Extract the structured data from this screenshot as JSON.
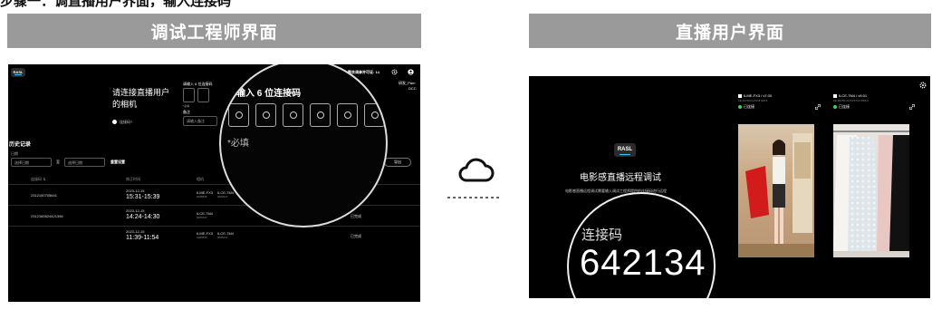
{
  "top_caption": "步骤一：调直播用户界面，输入连接码",
  "left_banner": "调试工程师界面",
  "right_banner": "直播用户界面",
  "engineer": {
    "logo": "RASL",
    "license": "剩余调参许可证: 14",
    "user_name": "研发_Pam",
    "user_sub": "DCC",
    "prompt_title": "请连接直播用户的相机",
    "link_hint": "连接码?",
    "code_label_small": "请输入 6 位连接码",
    "required_small": "*必填",
    "required_small2": "备注",
    "remark_placeholder": "请输入备注",
    "history_title": "历史记录",
    "filter_label": "日期",
    "filter_start": "选择日期",
    "filter_sep": "至",
    "filter_end": "选择日期",
    "reset_label": "重置设置",
    "export_label": "导出",
    "columns": [
      "连接码 ⇅",
      "修正时间",
      "相机",
      "状态"
    ],
    "rows": [
      {
        "code": "2312150705641",
        "date": "2023-12-15",
        "time": "15:31-15:39",
        "cam1": "ILME-FX3",
        "cam1_sn": "0005845",
        "cam2": "ILCE-7M4",
        "cam2_sn": "0005447",
        "status": "已完成"
      },
      {
        "code": "2312160524421396",
        "date": "2023-12-15",
        "time": "14:24-14:30",
        "cam1": "ILCE-7M4",
        "cam1_sn": "0005447",
        "cam2": "",
        "cam2_sn": "",
        "status": "已完成"
      },
      {
        "code": "",
        "date": "2023-12-15",
        "time": "11:39-11:54",
        "cam1": "ILME-FX3",
        "cam1_sn": "0005845",
        "cam2": "ILCE-7M4",
        "cam2_sn": "0005447",
        "status": "已完成"
      }
    ],
    "zoom_title": "请输入 6 位连接码",
    "zoom_required": "*必填"
  },
  "cloud_icon": "cloud-icon",
  "user": {
    "logo": "RASL",
    "title": "电影感直播远程调试",
    "subtitle": "电影感直播远程调试需要输入调试工程师提供的连接码进行远程",
    "cam1_model": "ILME-FX3 / v7.00",
    "cam1_lens": "FE 24-70mm F2.8 GM II",
    "cam1_status": "已连接",
    "cam2_model": "ILCE-7M4 / v5.01",
    "cam2_lens": "FE 28-70mm F3.5-5.6 OSS II",
    "cam2_status": "已连接",
    "code_label": "连接码",
    "code": "642134"
  }
}
